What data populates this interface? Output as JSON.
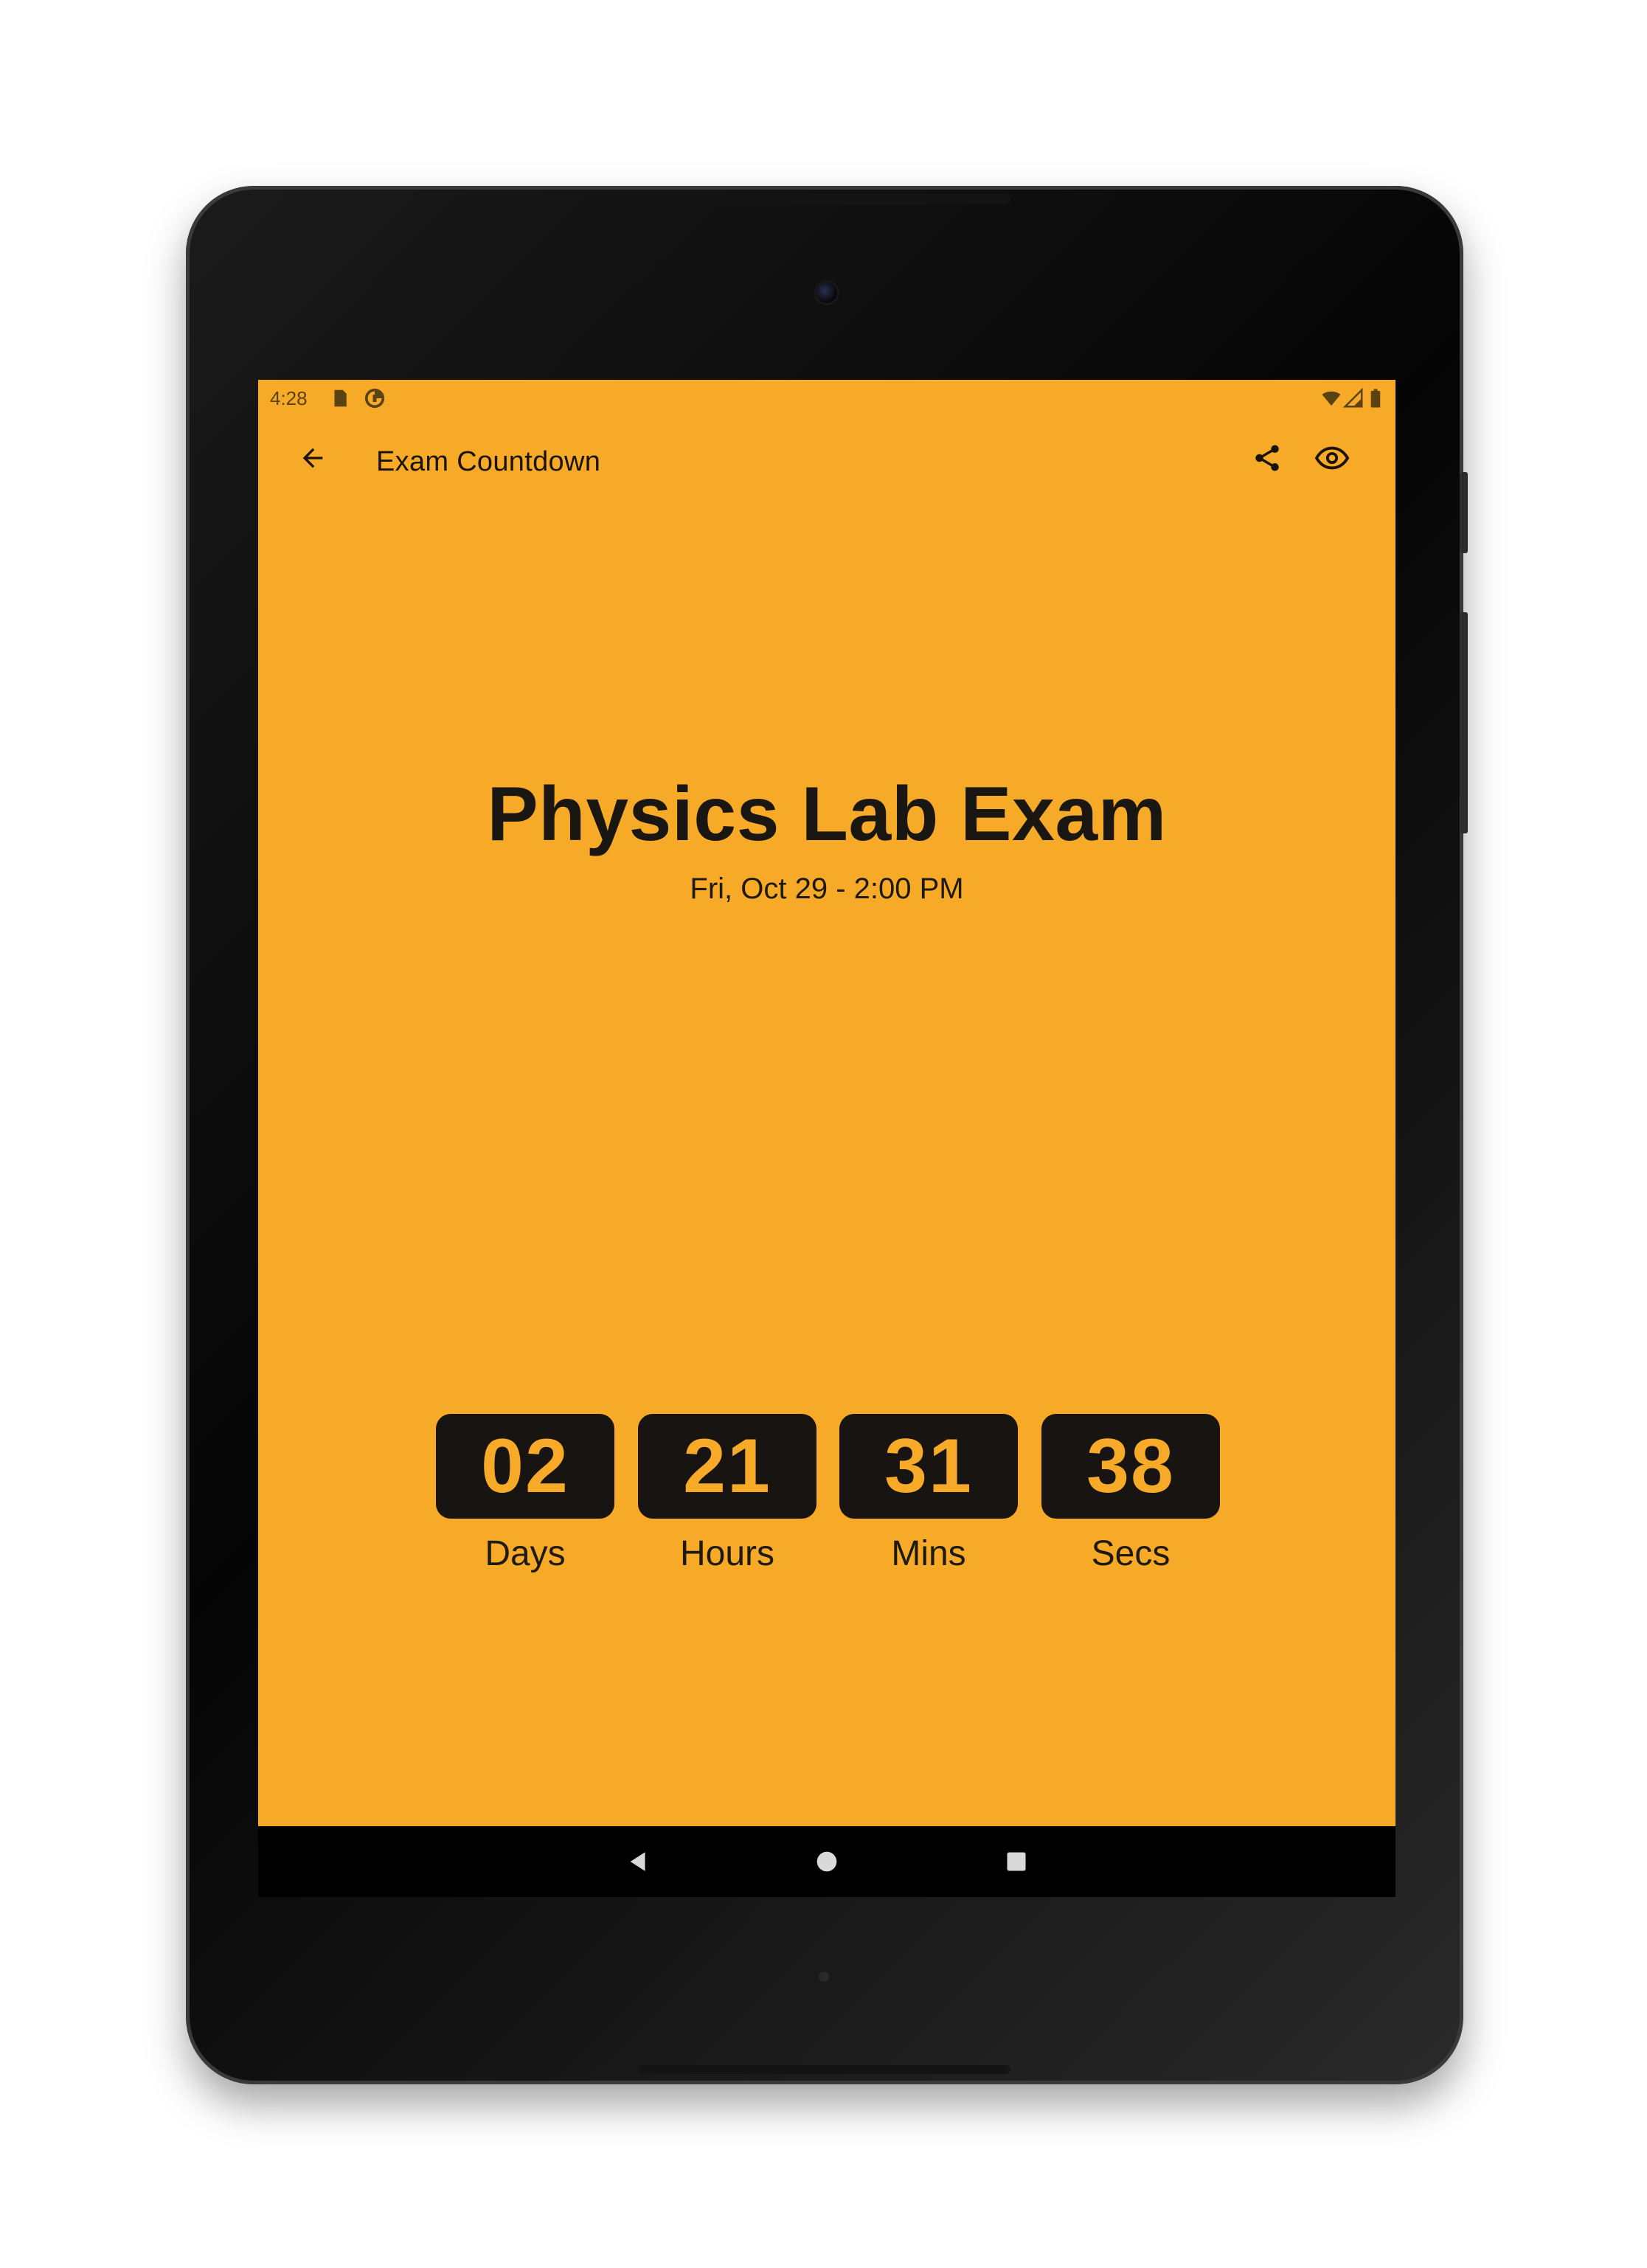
{
  "status_bar": {
    "time": "4:28"
  },
  "toolbar": {
    "title": "Exam Countdown",
    "back_icon": "arrow-left-icon",
    "share_icon": "share-icon",
    "view_icon": "eye-icon"
  },
  "event": {
    "title": "Physics Lab Exam",
    "date": "Fri, Oct 29 - 2:00 PM"
  },
  "countdown": [
    {
      "value": "02",
      "label": "Days"
    },
    {
      "value": "21",
      "label": "Hours"
    },
    {
      "value": "31",
      "label": "Mins"
    },
    {
      "value": "38",
      "label": "Secs"
    }
  ],
  "nav_bar": {
    "back_icon": "triangle-back-icon",
    "home_icon": "circle-home-icon",
    "recents_icon": "square-recents-icon"
  },
  "colors": {
    "background": "#f7a928",
    "text_dark": "#1a1712",
    "box_bg": "#171411",
    "box_text": "#f7a928"
  }
}
